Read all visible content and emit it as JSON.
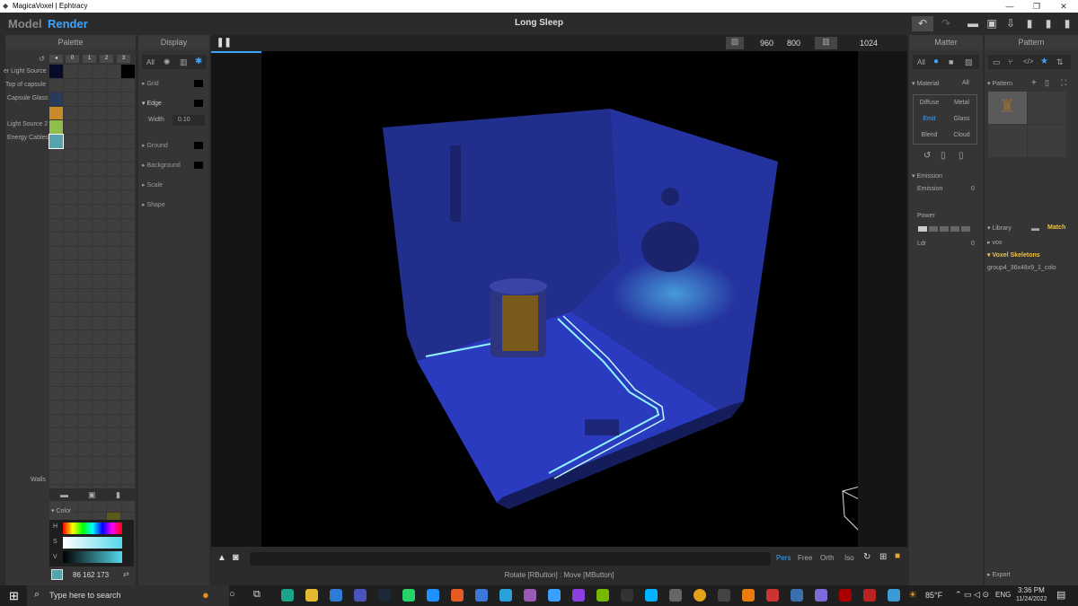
{
  "window": {
    "title": "MagicaVoxel | Ephtracy"
  },
  "topbar": {
    "mode_model": "Model",
    "mode_render": "Render",
    "doc_title": "Long Sleep"
  },
  "palette": {
    "header": "Palette",
    "tabs": [
      "0",
      "1",
      "2",
      "3"
    ],
    "labels": [
      "er Light Source",
      "Top of capsule",
      "Capsule Glass",
      "Light Source 2",
      "Energy Cables",
      "Walls"
    ],
    "color_section": "Color",
    "hsv": [
      "H",
      "S",
      "V"
    ],
    "rgb": "86  162  173",
    "selected_color": "#56a2ad"
  },
  "display": {
    "header": "Display",
    "filter_all": "All",
    "sections": [
      "Grid",
      "Edge",
      "Ground",
      "Background",
      "Scale",
      "Shape"
    ],
    "width_label": "Width",
    "width_value": "0.10"
  },
  "viewport": {
    "width": "960",
    "height": "800",
    "samples": "1024",
    "proj": [
      "Pers",
      "Free",
      "Orth",
      "Iso"
    ],
    "active_proj": "Pers",
    "hint": "Rotate [RButton] : Move [MButton]"
  },
  "matter": {
    "header": "Matter",
    "filter_all": "All",
    "material_label": "Material",
    "material_all": "All",
    "types": [
      "Diffuse",
      "Metal",
      "Emit",
      "Glass",
      "Blend",
      "Cloud"
    ],
    "active_type": "Emit",
    "emission_label": "Emission",
    "emission_field": "Emission",
    "emission_value": "0",
    "power_label": "Power",
    "ldr_label": "Ldr",
    "ldr_value": "0"
  },
  "pattern": {
    "header": "Pattern",
    "pattern_label": "Pattern",
    "library_label": "Library",
    "match_label": "Match",
    "folders": [
      "vox",
      "Voxel Skeletons"
    ],
    "file": "group4_36x48x9_1_colo",
    "export_label": "Export"
  },
  "taskbar": {
    "search_placeholder": "Type here to search",
    "weather": "85°F",
    "lang": "ENG",
    "time": "3:36 PM",
    "date": "11/24/2022"
  },
  "colors": {
    "accent": "#3ba5ff",
    "highlight": "#f0c040",
    "scene_blue": "#2a37a8",
    "glow": "#8ff4ff"
  }
}
